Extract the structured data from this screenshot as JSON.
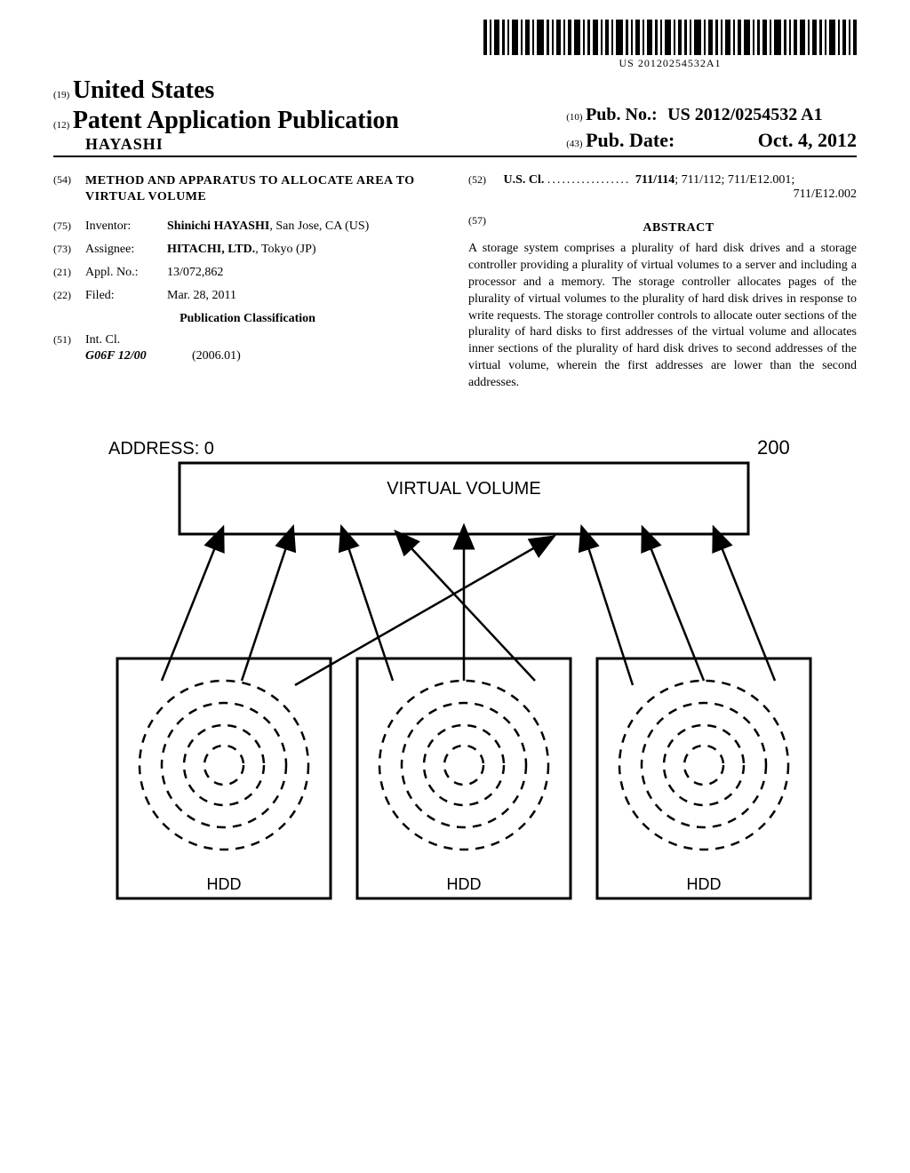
{
  "barcode_text": "US 20120254532A1",
  "header": {
    "country_code": "(19)",
    "country": "United States",
    "doc_type_code": "(12)",
    "doc_type": "Patent Application Publication",
    "author_surname": "HAYASHI",
    "pubno_code": "(10)",
    "pubno_label": "Pub. No.:",
    "pubno_value": "US 2012/0254532 A1",
    "pubdate_code": "(43)",
    "pubdate_label": "Pub. Date:",
    "pubdate_value": "Oct. 4, 2012"
  },
  "left_col": {
    "title_code": "(54)",
    "title": "METHOD AND APPARATUS TO ALLOCATE AREA TO VIRTUAL VOLUME",
    "inventor_code": "(75)",
    "inventor_label": "Inventor:",
    "inventor_value_bold": "Shinichi HAYASHI",
    "inventor_value_rest": ", San Jose, CA (US)",
    "assignee_code": "(73)",
    "assignee_label": "Assignee:",
    "assignee_value_bold": "HITACHI, LTD.",
    "assignee_value_rest": ", Tokyo (JP)",
    "applno_code": "(21)",
    "applno_label": "Appl. No.:",
    "applno_value": "13/072,862",
    "filed_code": "(22)",
    "filed_label": "Filed:",
    "filed_value": "Mar. 28, 2011",
    "pubclass_heading": "Publication Classification",
    "intcl_code": "(51)",
    "intcl_label": "Int. Cl.",
    "intcl_class": "G06F 12/00",
    "intcl_date": "(2006.01)"
  },
  "right_col": {
    "uscl_code": "(52)",
    "uscl_label": "U.S. Cl.",
    "uscl_main": "711/114",
    "uscl_rest_line1": "; 711/112; 711/E12.001;",
    "uscl_line2": "711/E12.002",
    "abstract_code": "(57)",
    "abstract_heading": "ABSTRACT",
    "abstract_text": "A storage system comprises a plurality of hard disk drives and a storage controller providing a plurality of virtual volumes to a server and including a processor and a memory. The storage controller allocates pages of the plurality of virtual volumes to the plurality of hard disk drives in response to write requests. The storage controller controls to allocate outer sections of the plurality of hard disks to first addresses of the virtual volume and allocates inner sections of the plurality of hard disk drives to second addresses of the virtual volume, wherein the first addresses are lower than the second addresses."
  },
  "figure": {
    "address_label": "ADDRESS: 0",
    "ref_num": "200",
    "virtual_volume_label": "VIRTUAL VOLUME",
    "hdd_label": "HDD"
  }
}
